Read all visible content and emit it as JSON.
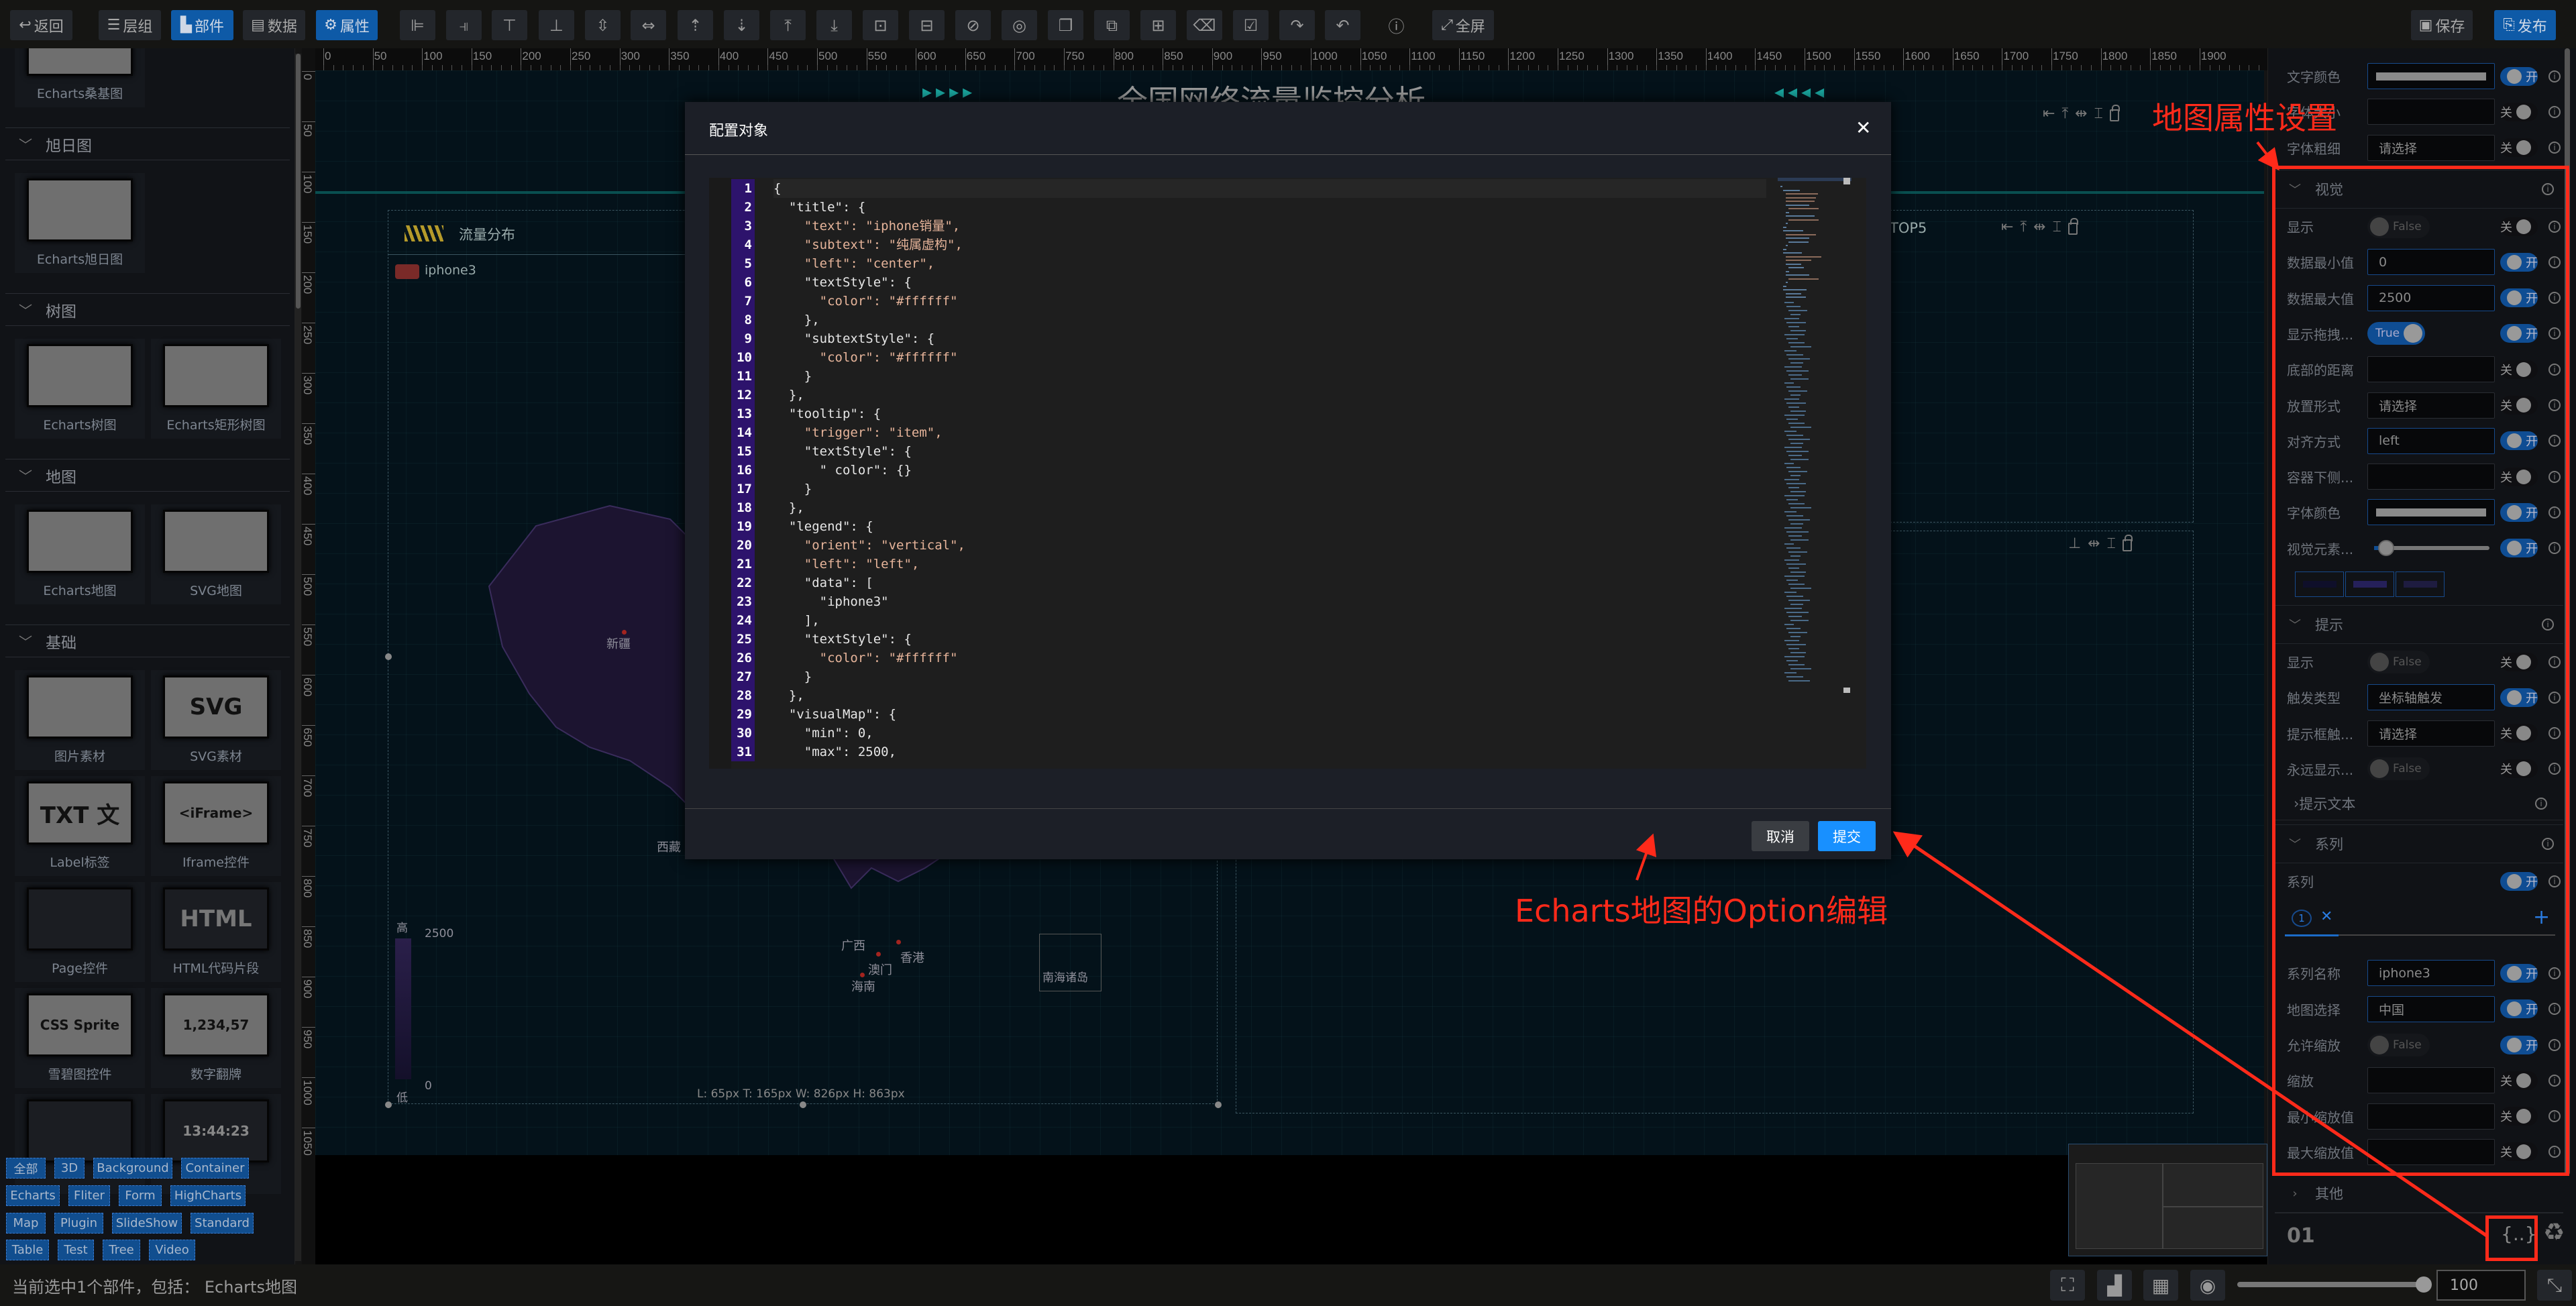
{
  "toolbar": {
    "back": "返回",
    "layers": "层组",
    "widgets": "部件",
    "data": "数据",
    "props": "属性",
    "fullscreen": "全屏",
    "save": "保存",
    "publish": "发布",
    "tools": [
      "align-left",
      "align-right",
      "align-top",
      "align-bottom",
      "align-vcenter",
      "align-hcenter",
      "move-up",
      "move-down",
      "move-top",
      "move-bottom",
      "lock",
      "unlock",
      "hide",
      "show",
      "copy",
      "duplicate",
      "add",
      "delete",
      "select",
      "redo",
      "undo",
      "info"
    ],
    "accent": "#0e5aa7"
  },
  "left_panel": {
    "items": [
      {
        "kind": "cards",
        "cards": [
          {
            "label": "Echarts桑基图",
            "thumb": "sankey"
          }
        ]
      },
      {
        "kind": "header",
        "label": "旭日图"
      },
      {
        "kind": "cards",
        "cards": [
          {
            "label": "Echarts旭日图",
            "thumb": "sunburst"
          }
        ]
      },
      {
        "kind": "header",
        "label": "树图"
      },
      {
        "kind": "cards",
        "cards": [
          {
            "label": "Echarts树图",
            "thumb": "tree"
          },
          {
            "label": "Echarts矩形树图",
            "thumb": "treemap"
          }
        ]
      },
      {
        "kind": "header",
        "label": "地图"
      },
      {
        "kind": "cards",
        "cards": [
          {
            "label": "Echarts地图",
            "thumb": "map"
          },
          {
            "label": "SVG地图",
            "thumb": "svgmap"
          }
        ]
      },
      {
        "kind": "header",
        "label": "基础"
      },
      {
        "kind": "cards",
        "cards": [
          {
            "label": "图片素材",
            "thumb": "image"
          },
          {
            "label": "SVG素材",
            "thumb": "svg",
            "thumb_text": "SVG"
          }
        ]
      },
      {
        "kind": "cards",
        "cards": [
          {
            "label": "Label标签",
            "thumb": "label",
            "thumb_text": "TXT 文"
          },
          {
            "label": "Iframe控件",
            "thumb": "iframe",
            "thumb_text": "<iFrame>"
          }
        ]
      },
      {
        "kind": "cards",
        "cards": [
          {
            "label": "Page控件",
            "thumb": "page"
          },
          {
            "label": "HTML代码片段",
            "thumb": "html",
            "thumb_text": "HTML"
          }
        ]
      },
      {
        "kind": "cards",
        "cards": [
          {
            "label": "雪碧图控件",
            "thumb": "sprite",
            "thumb_text": "CSS Sprite"
          },
          {
            "label": "数字翻牌",
            "thumb": "flip",
            "thumb_text": "1,234,57"
          }
        ]
      },
      {
        "kind": "cards",
        "cards": [
          {
            "label": "",
            "thumb": "led"
          },
          {
            "label": "",
            "thumb": "clock",
            "thumb_text": "13:44:23"
          }
        ]
      }
    ],
    "tags": [
      "全部",
      "3D",
      "Background",
      "Container",
      "Echarts",
      "Fliter",
      "Form",
      "HighCharts",
      "Map",
      "Plugin",
      "SlideShow",
      "Standard",
      "Table",
      "Test",
      "Tree",
      "Video"
    ]
  },
  "ruler": {
    "h_labels": [
      0,
      50,
      100,
      150,
      200,
      250,
      300,
      350,
      400,
      450,
      500,
      550,
      600,
      650,
      700,
      750,
      800,
      850,
      900,
      950,
      1000,
      1050,
      1100,
      1150,
      1200,
      1250,
      1300,
      1350,
      1400,
      1450,
      1500,
      1550,
      1600,
      1650,
      1700,
      1750,
      1800,
      1850,
      1900
    ],
    "v_labels": [
      0,
      50,
      100,
      150,
      200,
      250,
      300,
      350,
      400,
      450,
      500,
      550,
      600,
      650,
      700,
      750,
      800,
      850,
      900,
      950,
      1000,
      1050
    ]
  },
  "canvas": {
    "title": "全国网络流量监控分析",
    "map_widget": {
      "header": "流量分布",
      "legend": "iphone3",
      "legend_color": "#7a2a28",
      "labels": [
        "新疆",
        "西藏",
        "广西",
        "澳门",
        "香港",
        "海南"
      ],
      "south_sea": "南海诸岛",
      "vm_high": "高",
      "vm_low": "低",
      "vm_max": "2500",
      "vm_min": "0",
      "geometry_readout": "L: 65px T: 165px W: 826px H: 863px"
    },
    "top_widget_header": "TOP5"
  },
  "dialog": {
    "title": "配置对象",
    "cancel": "取消",
    "submit": "提交",
    "submit_color": "#1890ff",
    "code_lines": [
      "{",
      "  \"title\": {",
      "    \"text\": \"iphone销量\",",
      "    \"subtext\": \"纯属虚构\",",
      "    \"left\": \"center\",",
      "    \"textStyle\": {",
      "      \"color\": \"#ffffff\"",
      "    },",
      "    \"subtextStyle\": {",
      "      \"color\": \"#ffffff\"",
      "    }",
      "  },",
      "  \"tooltip\": {",
      "    \"trigger\": \"item\",",
      "    \"textStyle\": {",
      "      \" color\": {}",
      "    }",
      "  },",
      "  \"legend\": {",
      "    \"orient\": \"vertical\",",
      "    \"left\": \"left\",",
      "    \"data\": [",
      "      \"iphone3\"",
      "    ],",
      "    \"textStyle\": {",
      "      \"color\": \"#ffffff\"",
      "    }",
      "  },",
      "  \"visualMap\": {",
      "    \"min\": 0,",
      "    \"max\": 2500,"
    ]
  },
  "right_panel": {
    "on_text": "开",
    "off_text": "关",
    "items": [
      {
        "kind": "row",
        "label": "文字颜色",
        "control": "color",
        "value": "#8a8a8a",
        "on": true
      },
      {
        "kind": "row",
        "label": "字体大小",
        "control": "input",
        "value": "",
        "on": false
      },
      {
        "kind": "row",
        "label": "字体粗细",
        "control": "select",
        "value": "请选择",
        "on": false
      },
      {
        "kind": "header",
        "label": "视觉",
        "expanded": true
      },
      {
        "kind": "row",
        "label": "显示",
        "control": "switch",
        "value": "False",
        "on": false
      },
      {
        "kind": "row",
        "label": "数据最小值",
        "control": "input",
        "value": "0",
        "on": true
      },
      {
        "kind": "row",
        "label": "数据最大值",
        "control": "input",
        "value": "2500",
        "on": true
      },
      {
        "kind": "row",
        "label": "显示拖拽...",
        "control": "switch",
        "value": "True",
        "on": true
      },
      {
        "kind": "row",
        "label": "底部的距离",
        "control": "input",
        "value": "",
        "on": false
      },
      {
        "kind": "row",
        "label": "放置形式",
        "control": "select",
        "value": "请选择",
        "on": false
      },
      {
        "kind": "row",
        "label": "对齐方式",
        "control": "select",
        "value": "left",
        "on": true
      },
      {
        "kind": "row",
        "label": "容器下侧...",
        "control": "input",
        "value": "",
        "on": false
      },
      {
        "kind": "row",
        "label": "字体颜色",
        "control": "color",
        "value": "#8a8a8a",
        "on": true
      },
      {
        "kind": "row",
        "label": "视觉元素...",
        "control": "slider",
        "value": 5,
        "on": true
      },
      {
        "kind": "swatches",
        "colors": [
          "#0f0f2a",
          "#25205a",
          "#1e1c40"
        ]
      },
      {
        "kind": "header",
        "label": "提示",
        "expanded": true
      },
      {
        "kind": "row",
        "label": "显示",
        "control": "switch",
        "value": "False",
        "on": false
      },
      {
        "kind": "row",
        "label": "触发类型",
        "control": "select",
        "value": "坐标轴触发",
        "on": true
      },
      {
        "kind": "row",
        "label": "提示框触...",
        "control": "select",
        "value": "请选择",
        "on": false
      },
      {
        "kind": "row",
        "label": "永远显示...",
        "control": "switch",
        "value": "False",
        "on": false
      },
      {
        "kind": "sub",
        "label": "提示文本"
      },
      {
        "kind": "header",
        "label": "系列",
        "expanded": true
      },
      {
        "kind": "row",
        "label": "系列",
        "control": "none",
        "value": "",
        "on": true
      },
      {
        "kind": "tabs",
        "tab": "1"
      },
      {
        "kind": "row",
        "label": "系列名称",
        "control": "input",
        "value": "iphone3",
        "on": true
      },
      {
        "kind": "row",
        "label": "地图选择",
        "control": "select",
        "value": "中国",
        "on": true
      },
      {
        "kind": "row",
        "label": "允许缩放",
        "control": "switch",
        "value": "False",
        "on": true
      },
      {
        "kind": "row",
        "label": "缩放",
        "control": "input",
        "value": "",
        "on": false
      },
      {
        "kind": "row",
        "label": "最小缩放值",
        "control": "input",
        "value": "",
        "on": false
      },
      {
        "kind": "row",
        "label": "最大缩放值",
        "control": "input",
        "value": "",
        "on": false
      },
      {
        "kind": "header",
        "label": "其他",
        "expanded": false
      },
      {
        "kind": "footer",
        "page": "01",
        "code_button": "{..}"
      }
    ]
  },
  "statusbar": {
    "text": "当前选中1个部件，包括： Echarts地图",
    "zoom_value": "100",
    "zoom_percent": 100
  },
  "annotations": {
    "props_label": "地图属性设置",
    "option_label": "Echarts地图的Option编辑",
    "color": "#ff2a1a"
  }
}
